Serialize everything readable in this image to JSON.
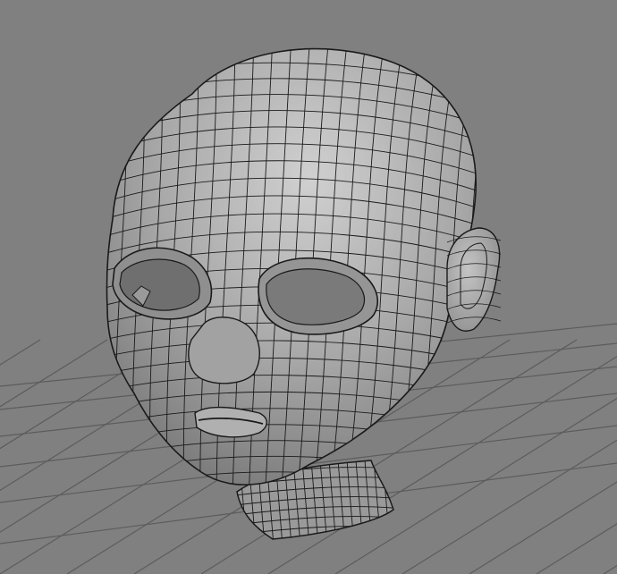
{
  "viewport": {
    "background_color": "#808080",
    "grid_color": "#5c5c5c",
    "mesh_fill_color": "#a9a9a9",
    "mesh_highlight_color": "#c9c9c9",
    "wire_color": "#1a1a1a",
    "shadow_color": "#4a4a4a",
    "object": "head-wireframe-mesh"
  }
}
